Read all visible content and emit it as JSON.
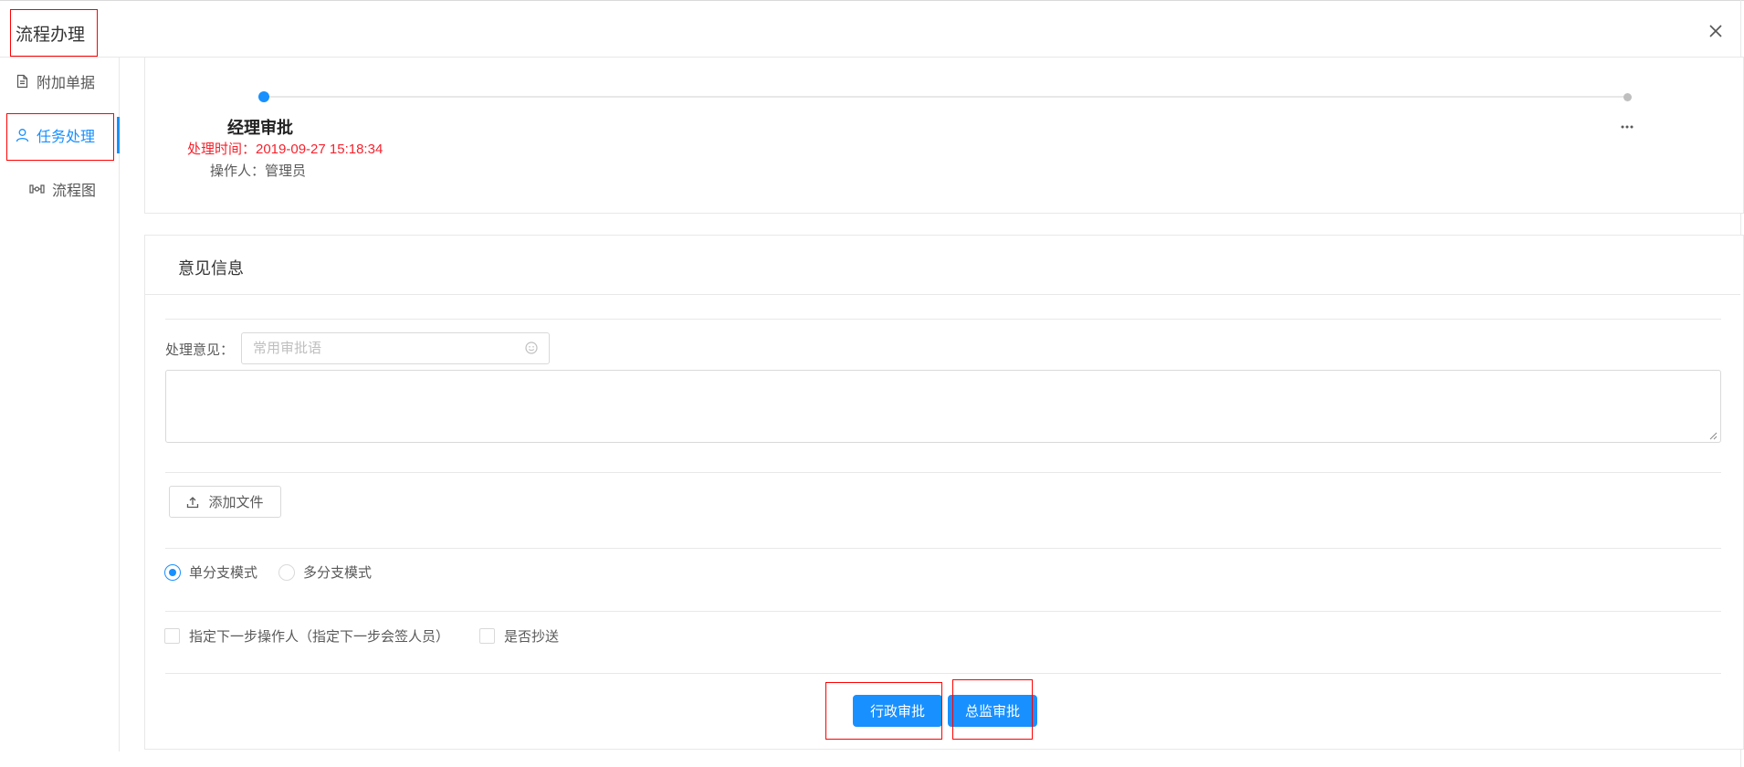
{
  "header": {
    "title": "流程办理",
    "close_icon": "close-icon"
  },
  "sidebar": {
    "items": [
      {
        "label": "附加单据",
        "icon": "document-icon"
      },
      {
        "label": "任务处理",
        "icon": "user-icon",
        "active": true
      },
      {
        "label": "流程图",
        "icon": "flowchart-icon"
      }
    ]
  },
  "process": {
    "step_title": "经理审批",
    "time_text": "处理时间：2019-09-27 15:18:34",
    "operator_text": "操作人：管理员",
    "more_icon": "ellipsis-icon"
  },
  "opinion": {
    "section_title": "意见信息",
    "label": "处理意见：",
    "common_placeholder": "常用审批语",
    "textarea_value": ""
  },
  "upload": {
    "button_label": "添加文件",
    "icon": "upload-icon"
  },
  "branch_mode": {
    "options": [
      {
        "label": "单分支模式",
        "checked": true
      },
      {
        "label": "多分支模式",
        "checked": false
      }
    ]
  },
  "options": {
    "next_operator_label": "指定下一步操作人（指定下一步会签人员）",
    "cc_label": "是否抄送"
  },
  "actions": {
    "admin_approve": "行政审批",
    "director_approve": "总监审批"
  },
  "colors": {
    "primary": "#1890ff",
    "danger_text": "#f5222d",
    "highlight_box": "#ff0000"
  }
}
